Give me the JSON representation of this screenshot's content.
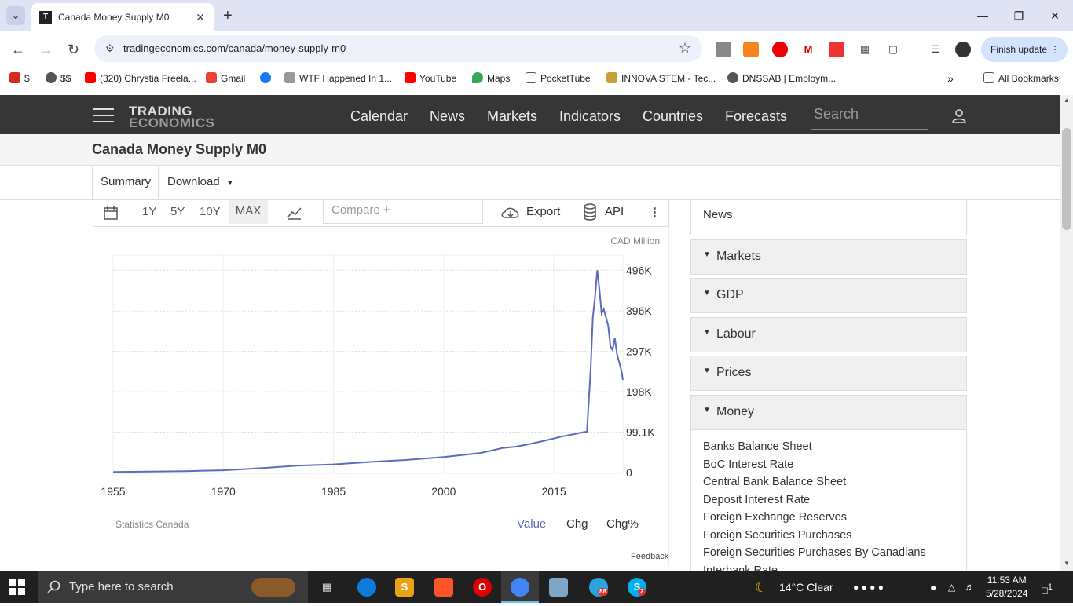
{
  "browser": {
    "tab_title": "Canada Money Supply M0",
    "tab_favicon": "T",
    "url": "tradingeconomics.com/canada/money-supply-m0",
    "finish_update": "Finish update",
    "bookmarks": [
      "$",
      "$$",
      "(320) Chrystia Freela...",
      "Gmail",
      "WTF Happened In 1...",
      "YouTube",
      "Maps",
      "PocketTube",
      "INNOVA STEM - Tec...",
      "DNSSAB | Employm...",
      "All Bookmarks"
    ]
  },
  "site": {
    "logo_line1": "TRADING",
    "logo_line2": "ECONOMICS",
    "nav": [
      "Calendar",
      "News",
      "Markets",
      "Indicators",
      "Countries",
      "Forecasts"
    ],
    "search_placeholder": "Search",
    "page_title": "Canada Money Supply M0",
    "subnav": {
      "summary": "Summary",
      "download": "Download"
    },
    "chart_toolbar": {
      "ranges": [
        "1Y",
        "5Y",
        "10Y",
        "MAX"
      ],
      "selected_range": "MAX",
      "compare_placeholder": "Compare +",
      "export": "Export",
      "api": "API"
    },
    "chart_footer": {
      "source": "Statistics Canada",
      "value": "Value",
      "chg": "Chg",
      "chgpct": "Chg%",
      "feedback": "Feedback"
    },
    "sidebar": {
      "news": "News",
      "sections": [
        "Markets",
        "GDP",
        "Labour",
        "Prices",
        "Money"
      ],
      "money_items": [
        "Banks Balance Sheet",
        "BoC Interest Rate",
        "Central Bank Balance Sheet",
        "Deposit Interest Rate",
        "Foreign Exchange Reserves",
        "Foreign Securities Purchases",
        "Foreign Securities Purchases By Canadians",
        "Interbank Rate"
      ]
    },
    "colors": {
      "line": "#5c6bc0",
      "nav_bg": "#363636",
      "accent_value": "#5c6bc0"
    }
  },
  "chart_data": {
    "type": "line",
    "unit": "CAD Million",
    "x_ticks": [
      "1955",
      "1970",
      "1985",
      "2000",
      "2015"
    ],
    "y_ticks": [
      "0",
      "99.1K",
      "198K",
      "297K",
      "396K",
      "496K"
    ],
    "ylim": [
      0,
      535000
    ],
    "xlim": [
      1955,
      2024.4
    ],
    "series": [
      {
        "x": [
          1955,
          1960,
          1965,
          1970,
          1975,
          1980,
          1985,
          1990,
          1995,
          2000,
          2005,
          2008,
          2010,
          2012,
          2014,
          2016,
          2018,
          2019,
          2019.5,
          2020.0,
          2020.3,
          2020.6,
          2020.9,
          2021.2,
          2021.5,
          2021.8,
          2022.1,
          2022.4,
          2022.7,
          2023.0,
          2023.3,
          2023.6,
          2023.9,
          2024.2,
          2024.4
        ],
        "y": [
          1500,
          2300,
          3500,
          5500,
          10500,
          17000,
          20000,
          26000,
          31000,
          38000,
          48000,
          60000,
          64000,
          71000,
          79000,
          88000,
          95000,
          99000,
          100000,
          250000,
          380000,
          430000,
          496000,
          450000,
          390000,
          400000,
          380000,
          360000,
          310000,
          300000,
          330000,
          290000,
          270000,
          250000,
          227000
        ]
      }
    ]
  },
  "taskbar": {
    "search_placeholder": "Type here to search",
    "weather": "14°C  Clear",
    "time": "11:53 AM",
    "date": "5/28/2024",
    "notifications": "1",
    "telegram_badge": "88",
    "skype_badge": "2"
  }
}
